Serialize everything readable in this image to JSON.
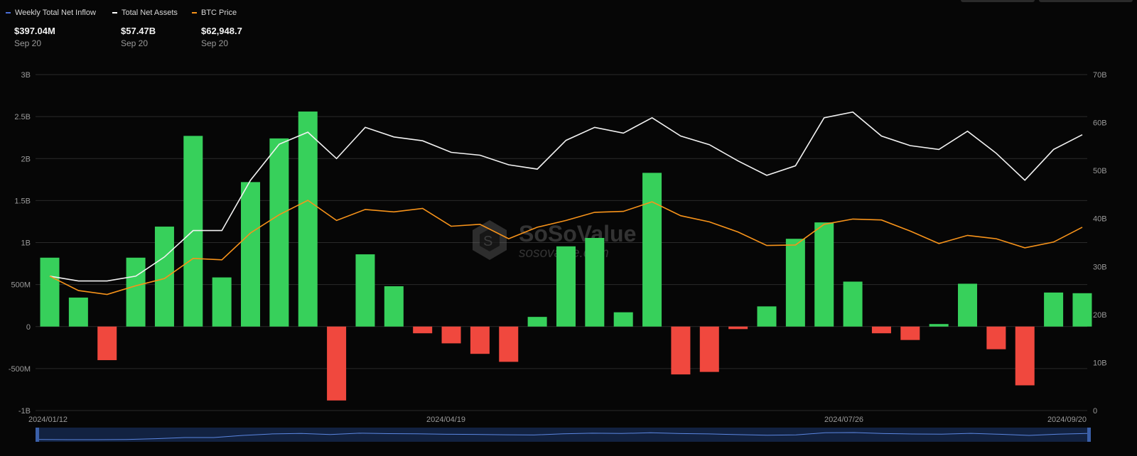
{
  "legend": [
    {
      "label": "Weekly Total Net Inflow",
      "color": "#4a6fd8"
    },
    {
      "label": "Total Net Assets",
      "color": "#ffffff"
    },
    {
      "label": "BTC Price",
      "color": "#f7931a"
    }
  ],
  "summary": [
    {
      "value": "$397.04M",
      "date": "Sep 20"
    },
    {
      "value": "$57.47B",
      "date": "Sep 20"
    },
    {
      "value": "$62,948.7",
      "date": "Sep 20"
    }
  ],
  "watermark": {
    "brand": "SoSoValue",
    "site": "sosovalue.com",
    "icon": "sosovalue-logo-icon"
  },
  "colors": {
    "positive": "#37d05b",
    "negative": "#f0483e",
    "assets": "#f2f2f2",
    "btc": "#f7931a",
    "grid": "#2a2a2a",
    "navigator": "#1d3a73"
  },
  "chart_data": {
    "type": "bar",
    "x_labels": [
      "2024/01/12",
      "2024/04/19",
      "2024/07/26",
      "2024/09/20"
    ],
    "y_left": {
      "ticks": [
        "3B",
        "2.5B",
        "2B",
        "1.5B",
        "1B",
        "500M",
        "0",
        "-500M",
        "-1B"
      ],
      "ylim": [
        -1000,
        3000
      ],
      "unit": "M USD"
    },
    "y_right": {
      "ticks": [
        "70B",
        "60B",
        "50B",
        "40B",
        "30B",
        "20B",
        "10B",
        "0"
      ],
      "ylim": [
        0,
        70
      ],
      "unit": "B USD"
    },
    "series": [
      {
        "name": "Weekly Total Net Inflow",
        "type": "bar",
        "values": [
          820,
          345,
          -400,
          820,
          1190,
          2270,
          585,
          1720,
          2240,
          2560,
          -880,
          860,
          480,
          -80,
          -200,
          -325,
          -420,
          115,
          955,
          1055,
          170,
          1830,
          -570,
          -540,
          -30,
          240,
          1045,
          1240,
          535,
          -80,
          -160,
          30,
          510,
          -270,
          -700,
          405,
          397
        ]
      },
      {
        "name": "Total Net Assets",
        "type": "line",
        "values": [
          28,
          27,
          27,
          28,
          32,
          37.5,
          37.5,
          48,
          55.5,
          58,
          52.5,
          59,
          57,
          56.2,
          53.8,
          53.2,
          51.2,
          50.3,
          56.3,
          59,
          57.8,
          61,
          57.2,
          55.4,
          52,
          49,
          51,
          61,
          62.2,
          57.2,
          55.2,
          54.4,
          58.2,
          53.6,
          48,
          54.4,
          57.47
        ]
      },
      {
        "name": "BTC Price",
        "type": "line",
        "values": [
          28,
          25,
          24.2,
          26,
          27.5,
          31.7,
          31.4,
          37,
          40.8,
          43.8,
          39.6,
          41.9,
          41.4,
          42.1,
          38.4,
          38.8,
          35.8,
          38.2,
          39.6,
          41.3,
          41.5,
          43.5,
          40.6,
          39.3,
          37.2,
          34.4,
          34.5,
          38.8,
          39.9,
          39.7,
          37.4,
          34.8,
          36.5,
          35.8,
          33.9,
          35.1,
          38.2
        ]
      }
    ]
  }
}
